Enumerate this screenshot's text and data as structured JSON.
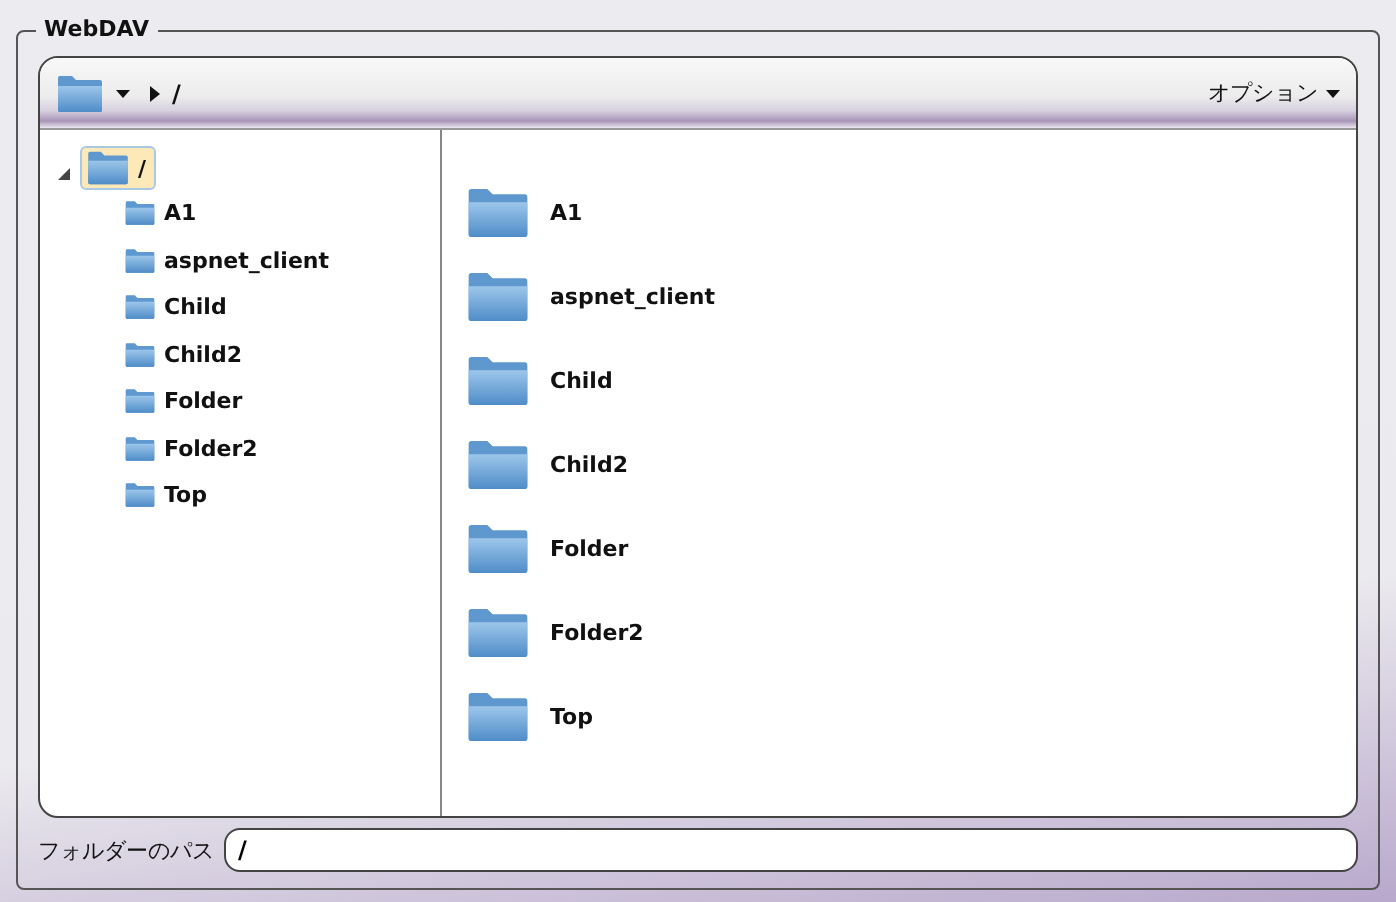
{
  "group_title": "WebDAV",
  "toolbar": {
    "path_separator": "/",
    "options_label": "オプション"
  },
  "tree": {
    "label": "/",
    "selected": true,
    "expanded": true,
    "children": [
      {
        "label": "A1",
        "selected": false
      },
      {
        "label": "aspnet_client",
        "selected": false
      },
      {
        "label": "Child",
        "selected": false
      },
      {
        "label": "Child2",
        "selected": false
      },
      {
        "label": "Folder",
        "selected": false
      },
      {
        "label": "Folder2",
        "selected": false
      },
      {
        "label": "Top",
        "selected": false
      }
    ]
  },
  "items": [
    "A1",
    "aspnet_client",
    "Child",
    "Child2",
    "Folder",
    "Folder2",
    "Top"
  ],
  "path_field": {
    "label": "フォルダーのパス",
    "value": "/"
  }
}
